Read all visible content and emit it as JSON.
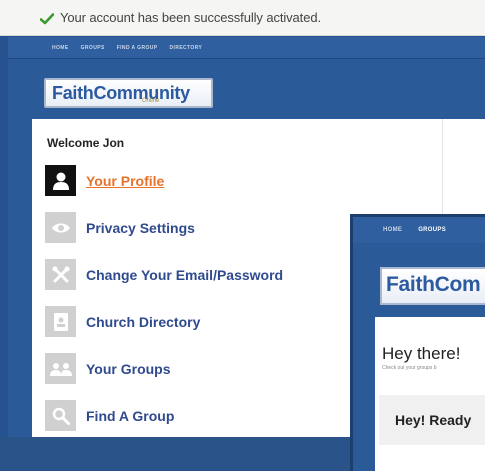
{
  "banner": {
    "message": "Your account has been successfully activated."
  },
  "nav": {
    "items": [
      "HOME",
      "GROUPS",
      "FIND A GROUP",
      "DIRECTORY"
    ]
  },
  "logo": {
    "word": "FaithCommunity",
    "tagline": "Online"
  },
  "welcome": "Welcome Jon",
  "menu": [
    {
      "label": "Your Profile",
      "icon": "person-icon",
      "active": true
    },
    {
      "label": "Privacy Settings",
      "icon": "eye-icon"
    },
    {
      "label": "Change Your Email/Password",
      "icon": "tools-icon"
    },
    {
      "label": "Church Directory",
      "icon": "directory-icon"
    },
    {
      "label": "Your Groups",
      "icon": "groups-icon"
    },
    {
      "label": "Find A Group",
      "icon": "search-icon"
    }
  ],
  "second_window": {
    "nav": [
      "HOME",
      "GROUPS"
    ],
    "logo_word": "FaithCom",
    "heading": "Hey there!",
    "subtext": "Check out your groups b",
    "ready_text": "Hey! Ready"
  },
  "colors": {
    "brand_blue": "#2b5a99",
    "link_blue": "#2f4a8e",
    "active_orange": "#e9722a",
    "success_green": "#3b9a2f"
  }
}
